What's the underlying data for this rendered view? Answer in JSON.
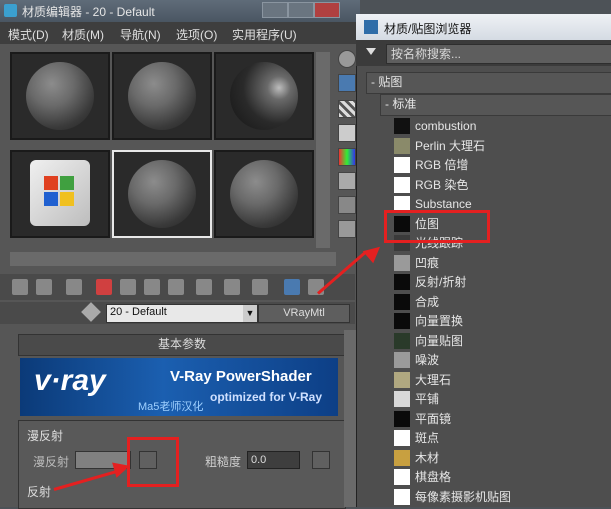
{
  "material_editor": {
    "title": "材质编辑器 - 20 - Default",
    "menu": [
      "模式(D)",
      "材质(M)",
      "导航(N)",
      "选项(O)",
      "实用程序(U)"
    ],
    "material_name": "20 - Default",
    "material_type": "VRayMtl",
    "rollout_title": "基本参数",
    "banner": {
      "logo": "v·ray",
      "title": "V-Ray PowerShader",
      "subtitle": "optimized for V-Ray",
      "credit": "Ma5老师汉化"
    },
    "diffuse_group": "漫反射",
    "diffuse_label": "漫反射",
    "roughness_label": "粗糙度",
    "roughness_value": "0.0",
    "reflect_group": "反射"
  },
  "browser": {
    "title": "材质/贴图浏览器",
    "search_placeholder": "按名称搜索...",
    "category": "- 贴图",
    "subcategory": "- 标准",
    "items": [
      {
        "label": "combustion",
        "swatch": "#111111"
      },
      {
        "label": "Perlin 大理石",
        "swatch": "#8a8a6a"
      },
      {
        "label": "RGB 倍增",
        "swatch": "#ffffff"
      },
      {
        "label": "RGB 染色",
        "swatch": "#ffffff"
      },
      {
        "label": "Substance",
        "swatch": "#ffffff"
      },
      {
        "label": "位图",
        "swatch": "#0a0a0a"
      },
      {
        "label": "光线跟踪",
        "swatch": "#3a3a3a"
      },
      {
        "label": "凹痕",
        "swatch": "#9a9a9a"
      },
      {
        "label": "反射/折射",
        "swatch": "#0a0a0a"
      },
      {
        "label": "合成",
        "swatch": "#0a0a0a"
      },
      {
        "label": "向量置换",
        "swatch": "#0a0a0a"
      },
      {
        "label": "向量贴图",
        "swatch": "#2a3a2a"
      },
      {
        "label": "噪波",
        "swatch": "#9a9a9a"
      },
      {
        "label": "大理石",
        "swatch": "#b0a880"
      },
      {
        "label": "平铺",
        "swatch": "#d8d8d8"
      },
      {
        "label": "平面镜",
        "swatch": "#0a0a0a"
      },
      {
        "label": "斑点",
        "swatch": "#ffffff"
      },
      {
        "label": "木材",
        "swatch": "#c8a040"
      },
      {
        "label": "棋盘格",
        "swatch": "#ffffff"
      },
      {
        "label": "每像素摄影机贴图",
        "swatch": "#ffffff"
      }
    ]
  },
  "colors": {
    "highlight": "#e42020",
    "vray_blue": "#1b5fb0"
  }
}
